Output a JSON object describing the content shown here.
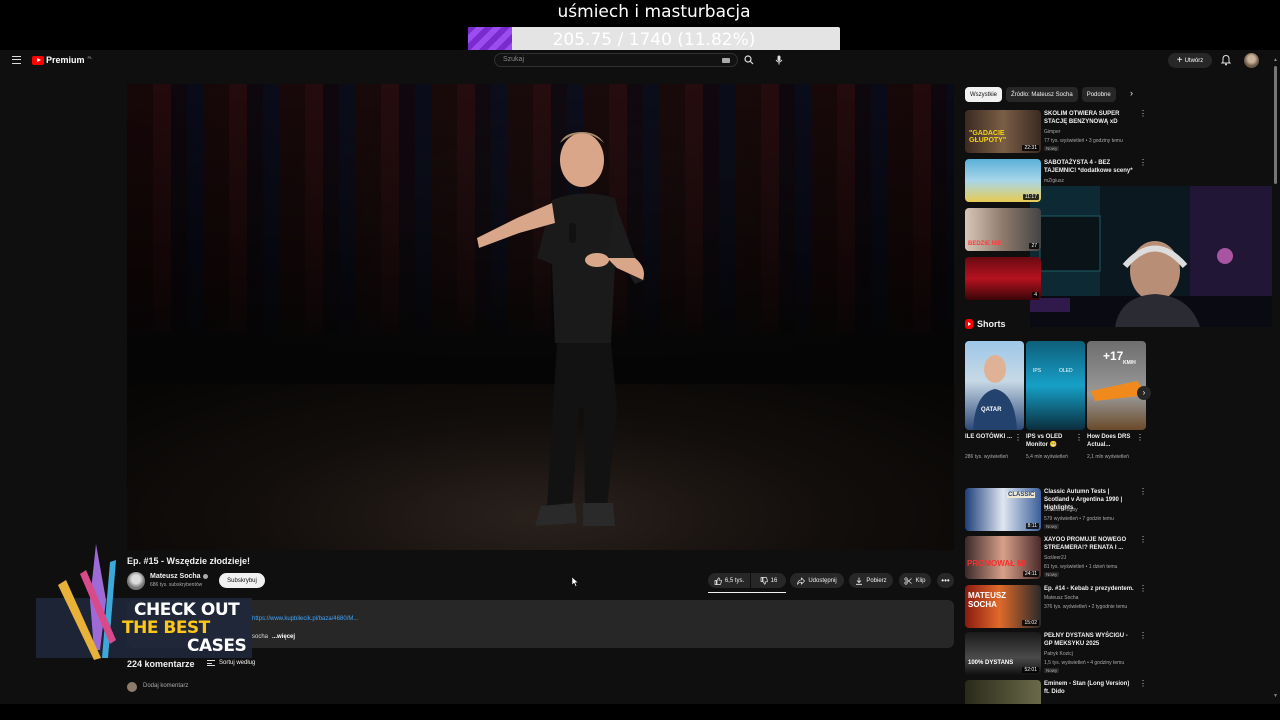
{
  "overlay": {
    "title": "uśmiech i masturbacja",
    "progress_text": "205.75 / 1740 (11.82%)",
    "progress_fraction": 0.1182
  },
  "topbar": {
    "logo_text": "Premium",
    "logo_region": "PL",
    "search_placeholder": "Szukaj",
    "create_label": "Utwórz"
  },
  "video": {
    "title": "Ep. #15 - Wszędzie złodzieje!",
    "channel": "Mateusz Socha",
    "subscribers": "686 tys. subskrybentów",
    "subscribe_label": "Subskrybuj",
    "likes": "6,5 tys.",
    "dislikes": "16",
    "share_label": "Udostępnij",
    "download_label": "Pobierz",
    "clip_label": "Klip",
    "description_link": "https://www.kupbilecik.pl/baza/4680/M...",
    "description_text": "socha",
    "description_more": "...więcej",
    "comments_count": "224 komentarze",
    "sort_label": "Sortuj według",
    "add_comment_placeholder": "Dodaj komentarz"
  },
  "promo": {
    "line1": "CHECK OUT",
    "line2": "THE BEST",
    "line3": "CASES"
  },
  "sidebar": {
    "chips": [
      "Wszystkie",
      "Źródło: Mateusz Socha",
      "Podobne"
    ],
    "recs_top": [
      {
        "title": "SKOLIM OTWIERA SUPER STACJĘ BENZYNOWĄ xD",
        "channel": "Gimper",
        "meta": "77 tys. wyświetleń • 3 godziny temu",
        "badge": "Nowy",
        "duration": "22:31",
        "thumb_text": "\"GADACIE GŁUPOTY\""
      },
      {
        "title": "SABOTAŻYSTA 4 - BEZ TAJEMNIC! *dodatkowe sceny*",
        "channel": "mZigiusz",
        "meta": "",
        "badge": "",
        "duration": "11:17",
        "thumb_text": ""
      },
      {
        "title": "",
        "channel": "",
        "meta": "",
        "badge": "",
        "duration": "27",
        "thumb_text": "BEDZIE NIE"
      },
      {
        "title": "",
        "channel": "",
        "meta": "",
        "badge": "",
        "duration": "4",
        "thumb_text": ""
      }
    ],
    "shorts_title": "Shorts",
    "shorts": [
      {
        "title": "ILE GOTÓWKI ...",
        "views": "286 tys. wyświetleń"
      },
      {
        "title": "IPS vs OLED Monitor 😬",
        "views": "5,4 mln wyświetleń"
      },
      {
        "title": "How Does DRS Actual...",
        "views": "2,1 mln wyświetleń"
      }
    ],
    "short_overlay": {
      "speed": "+17",
      "speed_unit": "KM/H",
      "label_ips": "IPS",
      "label_oled": "OLED",
      "jersey": "QATAR"
    },
    "recs_bottom": [
      {
        "title": "Classic Autumn Tests | Scotland v Argentina 1990 | Highlights",
        "channel": "Scottish Rugby",
        "meta": "579 wyświetleń • 7 godzin temu",
        "badge": "Nowy",
        "duration": "8:11",
        "thumb_text": "CLASSIC"
      },
      {
        "title": "XAYOO PROMUJE NOWEGO STREAMERA!? RENATA I ...",
        "channel": "Sośleer2J",
        "meta": "81 tys. wyświetleń • 1 dzień temu",
        "badge": "Nowy",
        "duration": "24:11",
        "thumb_text": "PROMOWAŁ MI"
      },
      {
        "title": "Ep. #14 - Kebab z prezydentem.",
        "channel": "Mateusz Socha",
        "meta": "376 tys. wyświetleń • 2 tygodnie temu",
        "badge": "",
        "duration": "15:02",
        "thumb_text": "MATEUSZ SOCHA"
      },
      {
        "title": "PEŁNY DYSTANS WYŚCIGU - GP MEKSYKU 2025",
        "channel": "Patryk Kozicj",
        "meta": "1,5 tys. wyświetleń • 4 godziny temu",
        "badge": "Nowy",
        "duration": "52:01",
        "thumb_text": "100% DYSTANS"
      },
      {
        "title": "Eminem - Stan (Long Version) ft. Dido",
        "channel": "",
        "meta": "",
        "badge": "",
        "duration": "",
        "thumb_text": ""
      }
    ]
  },
  "colors": {
    "accent_red": "#ff0000",
    "progress_purple": "#7a2bd0",
    "background": "#0f0f0f",
    "link_blue": "#3ea6ff"
  }
}
